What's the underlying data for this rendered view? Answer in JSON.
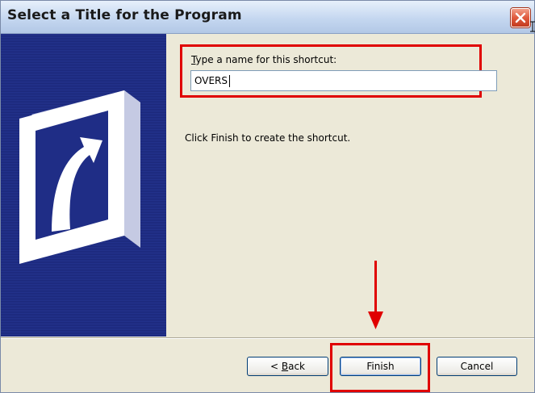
{
  "window": {
    "title": "Select a Title for the Program"
  },
  "name_prompt": {
    "label_prefix": "",
    "label_accel": "T",
    "label_rest": "ype a name for this shortcut:",
    "value": "OVERS"
  },
  "instruction": "Click Finish to create the shortcut.",
  "buttons": {
    "back_prefix": "< ",
    "back_accel": "B",
    "back_rest": "ack",
    "finish": "Finish",
    "cancel": "Cancel"
  },
  "colors": {
    "highlight": "#e00000",
    "side_panel": "#1d2a80",
    "dialog_bg": "#ece9d8"
  },
  "icons": [
    "close-icon",
    "shortcut-arrow-icon",
    "arrow-down-icon"
  ]
}
